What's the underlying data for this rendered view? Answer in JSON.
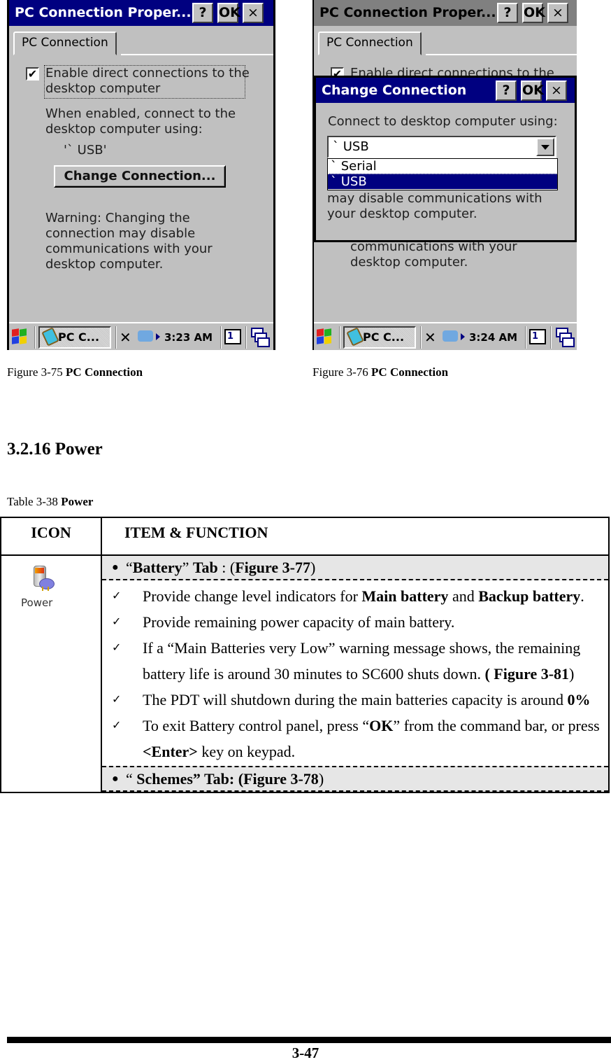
{
  "figures": [
    {
      "caption_prefix": "Figure 3-75 ",
      "caption_bold": "PC Connection",
      "window": {
        "title": "PC Connection Proper...",
        "help_label": "?",
        "ok_label": "OK",
        "close_label": "×",
        "tab": "PC Connection",
        "checkbox_checked": true,
        "checkbox_mark": "✔",
        "checkbox_label_1": "Enable direct connections to the",
        "checkbox_label_2": "desktop computer",
        "info_1": "When enabled, connect to the",
        "info_2": "desktop computer using:",
        "current_connection": "'` USB'",
        "change_button": "Change Connection...",
        "warning_1": "Warning: Changing the",
        "warning_2": "connection may disable",
        "warning_3": "communications with your",
        "warning_4": "desktop computer."
      },
      "taskbar": {
        "task_label": "PC C...",
        "clock": "3:23 AM",
        "input_icon_label": "1"
      }
    },
    {
      "caption_prefix": "Figure 3-76 ",
      "caption_bold": "PC Connection",
      "window": {
        "title": "PC Connection Proper...",
        "help_label": "?",
        "ok_label": "OK",
        "close_label": "×",
        "tab": "PC Connection",
        "checkbox_label_1": "Enable direct connections to the",
        "bg_text_1": "communications with your",
        "bg_text_2": "desktop computer."
      },
      "dialog": {
        "title": "Change Connection",
        "help_label": "?",
        "ok_label": "OK",
        "close_label": "×",
        "prompt": "Connect to desktop computer using:",
        "selected": "` USB",
        "options": [
          "` Serial",
          "` USB"
        ],
        "highlighted_option": "` USB",
        "text_1": "may disable communications with",
        "text_2": "your desktop computer."
      },
      "taskbar": {
        "task_label": "PC C...",
        "clock": "3:24 AM",
        "input_icon_label": "1"
      }
    }
  ],
  "section": {
    "heading": "3.2.16 Power"
  },
  "table": {
    "caption_prefix": "Table 3-38 ",
    "caption_bold": "Power",
    "headers": {
      "icon": "ICON",
      "item": "ITEM & FUNCTION"
    },
    "icon_label": "Power",
    "battery_tab": {
      "q1": "“",
      "bold1": "Battery",
      "q2": "” ",
      "bold2": "Tab",
      "rest": " : (",
      "fig": "Figure 3-77",
      "close": ")"
    },
    "items": [
      {
        "t1": "Provide change level indicators for ",
        "b1": "Main battery",
        "t2": " and ",
        "b2": "Backup battery",
        "t3": "."
      },
      {
        "t1": "Provide remaining power capacity of main battery."
      },
      {
        "t1": "If a “Main Batteries very Low” warning message shows, the remaining battery life is around 30 minutes to SC600 shuts down. ",
        "b1": "( Figure 3-81",
        "t2": ")"
      },
      {
        "t1": "The PDT will shutdown during the main batteries capacity is around ",
        "b1": "0%"
      },
      {
        "t1": "To exit Battery control panel, press “",
        "b1": "OK",
        "t2": "” from the command bar, or press ",
        "b2": "<Enter>",
        "t3": " key on keypad."
      }
    ],
    "check_mark": "✓",
    "bullet": "●",
    "schemes_tab": {
      "q1": "“ ",
      "bold": "Schemes” Tab: (",
      "fig": "Figure 3-78",
      "close": ")"
    }
  },
  "footer": {
    "page_number": "3-47"
  }
}
